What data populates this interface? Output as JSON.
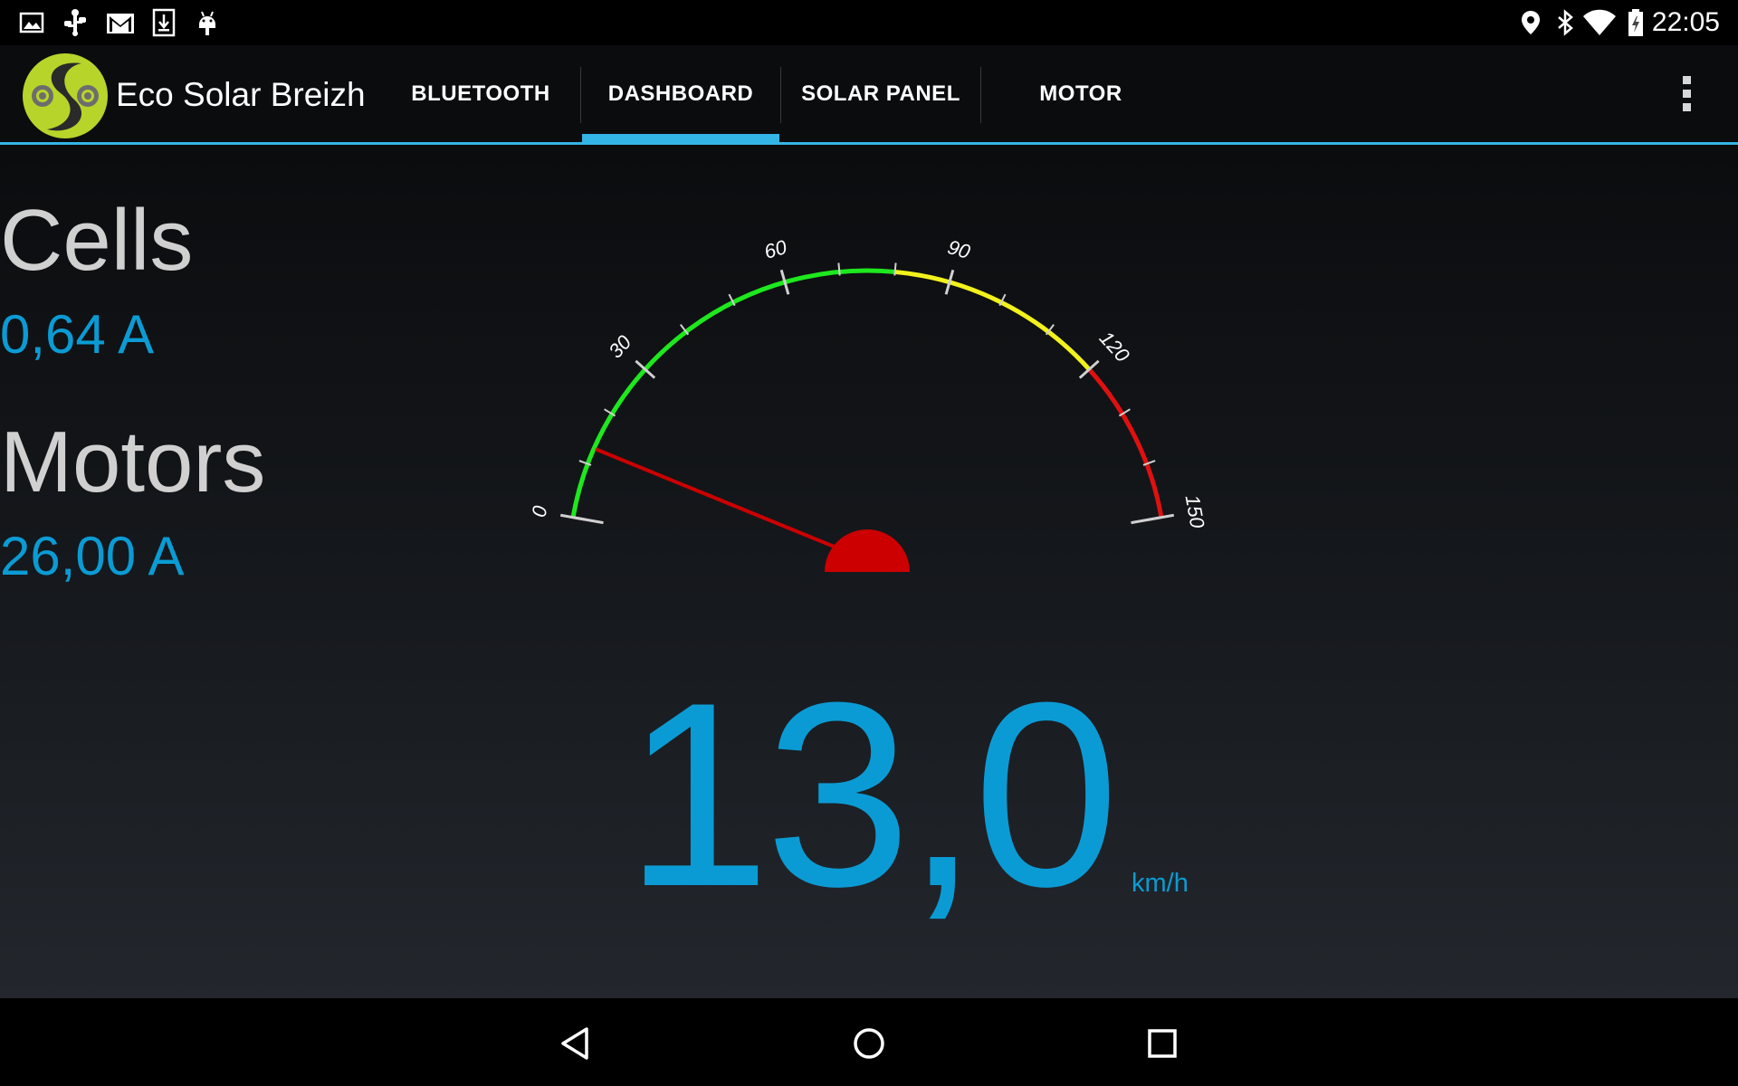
{
  "status_bar": {
    "time": "22:05",
    "left_icons": [
      "gallery-icon",
      "usb-debug-icon",
      "gmail-icon",
      "download-icon",
      "android-icon"
    ],
    "right_icons": [
      "location-icon",
      "bluetooth-icon",
      "wifi-icon",
      "battery-charging-icon"
    ]
  },
  "action_bar": {
    "app_title": "Eco Solar Breizh",
    "tabs": [
      {
        "label": "BLUETOOTH",
        "selected": false
      },
      {
        "label": "DASHBOARD",
        "selected": true
      },
      {
        "label": "SOLAR PANEL",
        "selected": false
      },
      {
        "label": "MOTOR",
        "selected": false
      }
    ],
    "accent_color": "#33b5e5"
  },
  "dashboard": {
    "cells": {
      "label": "Cells",
      "value": "0,64 A"
    },
    "motors": {
      "label": "Motors",
      "value": "26,00 A"
    },
    "speed": {
      "value": "13,0",
      "unit": "km/h",
      "value_number": 13.0
    },
    "gauge": {
      "min": 0,
      "max": 150,
      "tick_labels": [
        "0",
        "30",
        "60",
        "90",
        "120",
        "150"
      ],
      "zones": [
        {
          "from": 0,
          "to": 80,
          "color": "#1ee81e"
        },
        {
          "from": 80,
          "to": 120,
          "color": "#f2f21c"
        },
        {
          "from": 120,
          "to": 150,
          "color": "#e01010"
        }
      ],
      "needle_color": "#cc0000"
    }
  },
  "nav_bar": {
    "buttons": [
      "back-icon",
      "home-icon",
      "recents-icon"
    ]
  }
}
